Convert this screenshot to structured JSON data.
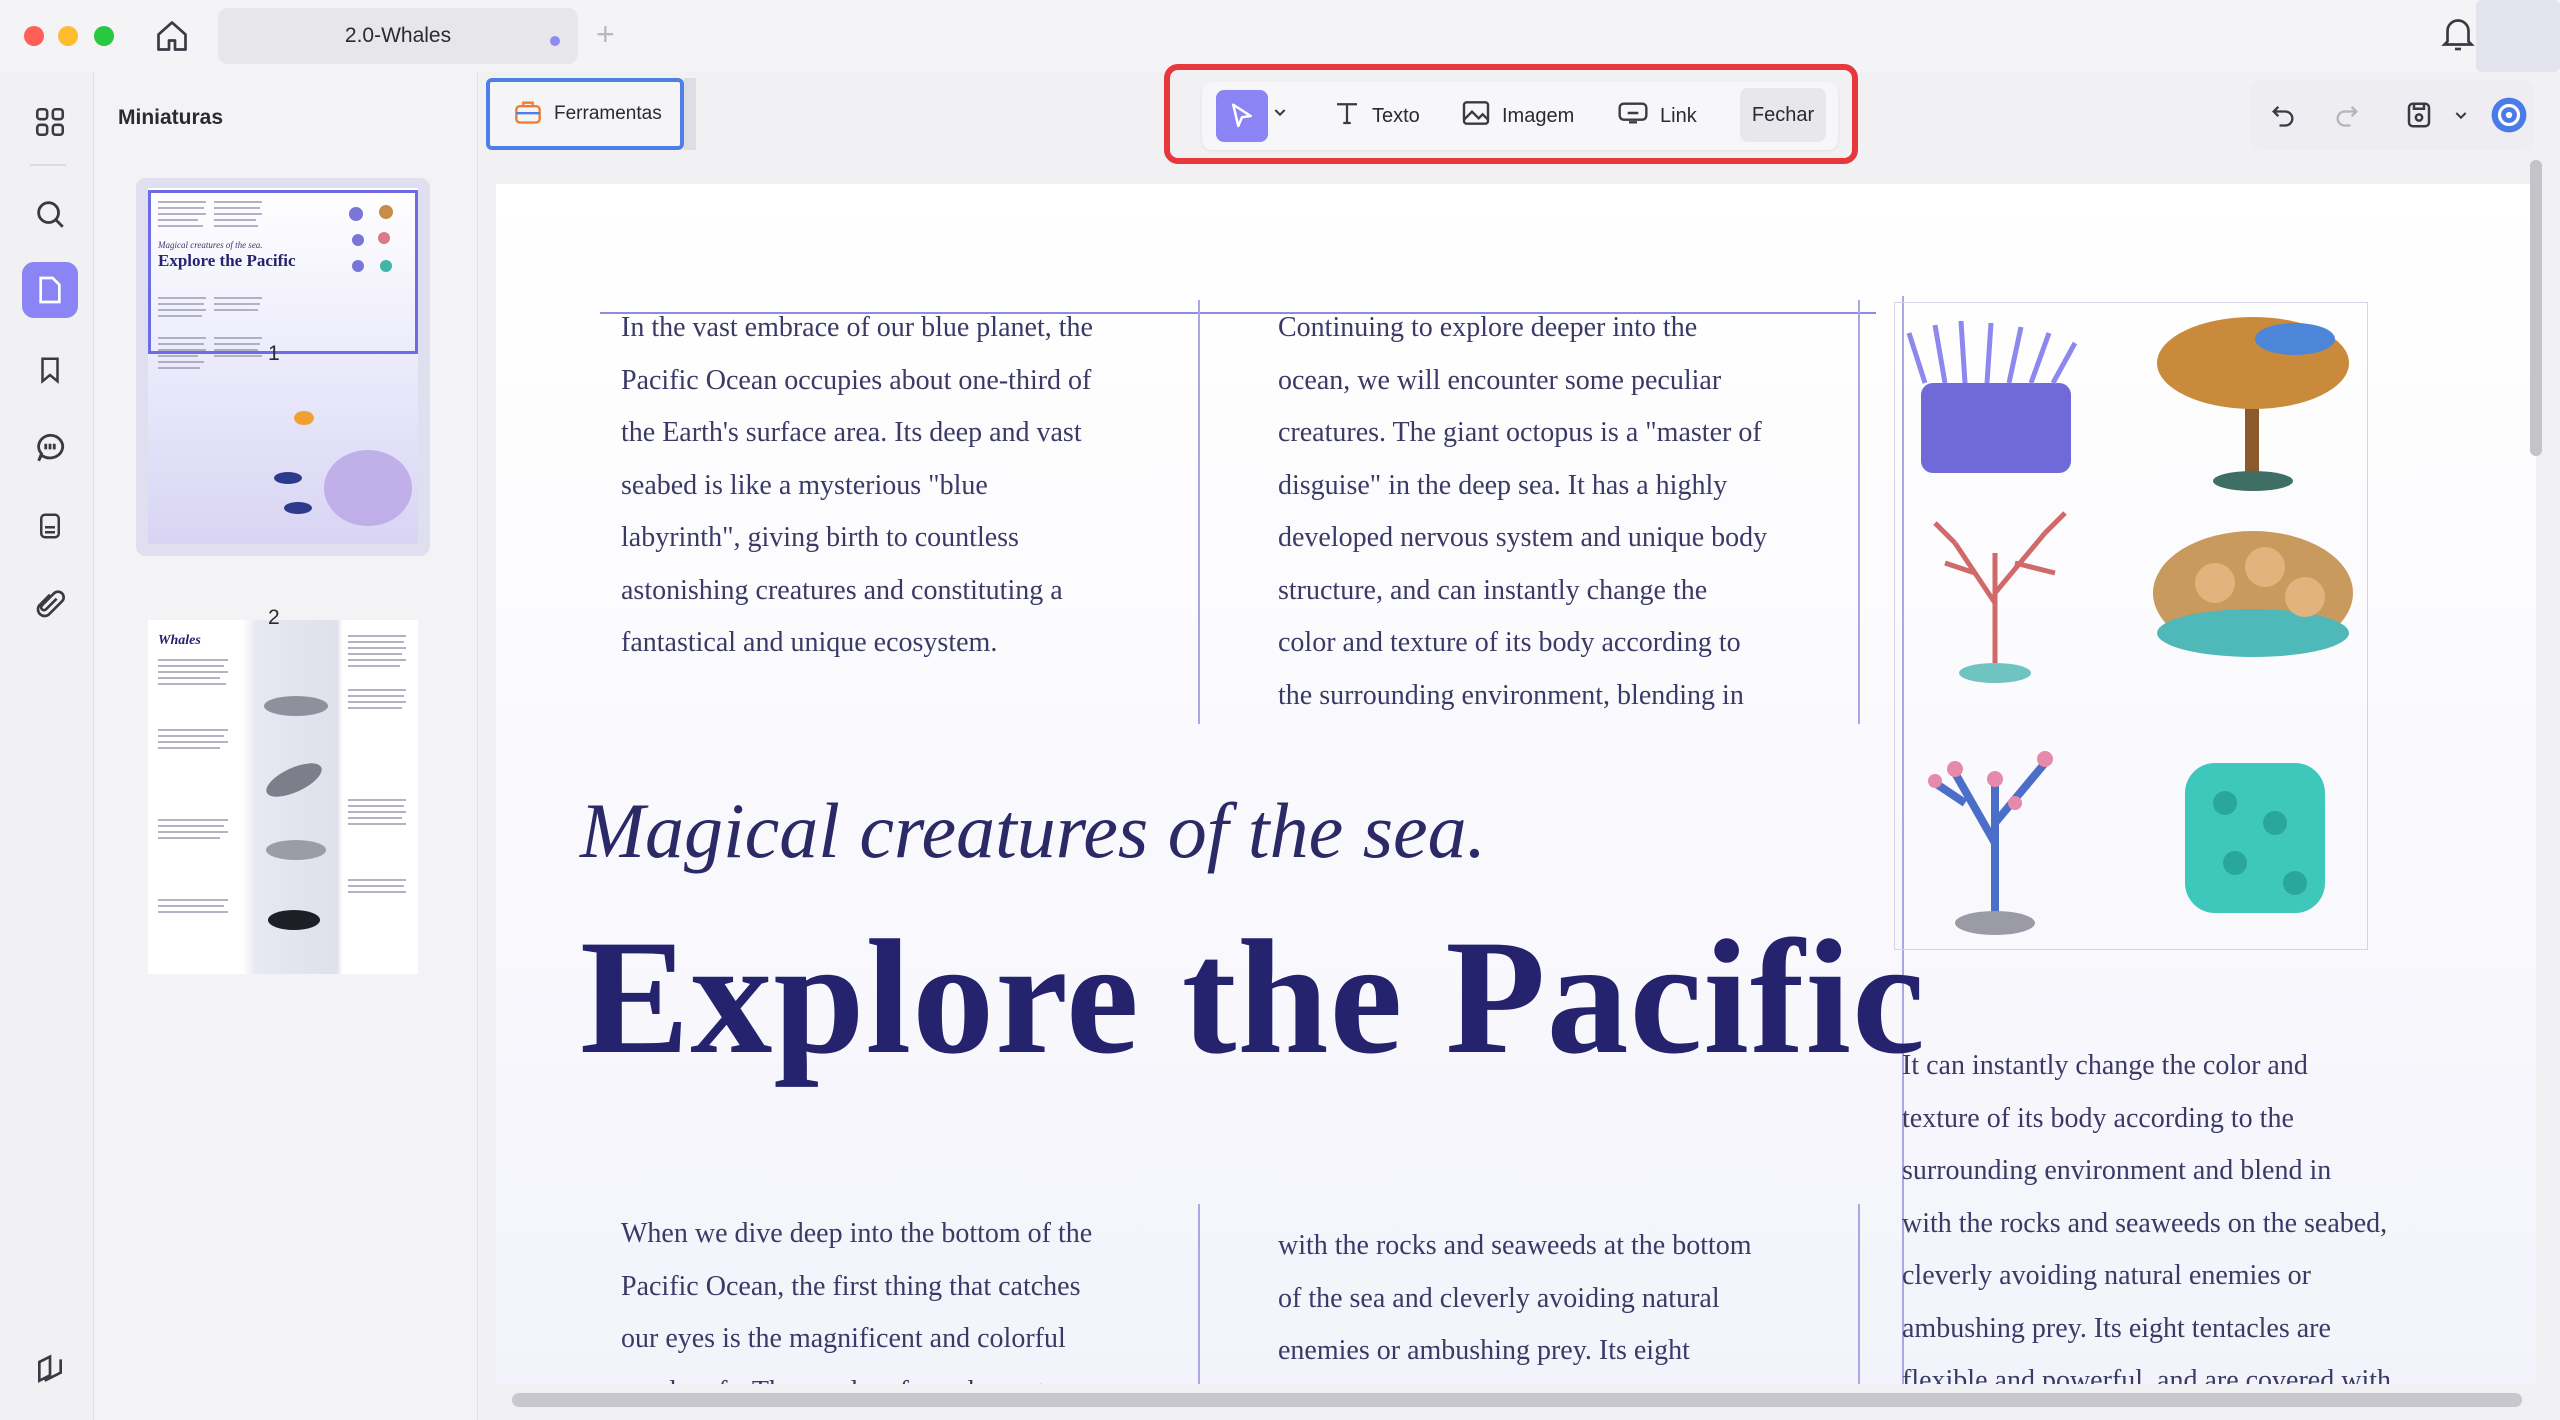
{
  "window": {
    "tab_title": "2.0-Whales",
    "new_tab_symbol": "+"
  },
  "sidebar": {
    "icons": [
      "grid-icon",
      "search-icon",
      "page-icon",
      "bookmark-icon",
      "comment-icon",
      "form-icon",
      "attachment-icon",
      "layers-icon"
    ],
    "active": "page-icon"
  },
  "thumbnails": {
    "title": "Miniaturas",
    "pages": [
      {
        "number": "1",
        "heading_script": "Magical creatures of the sea.",
        "heading": "Explore the Pacific"
      },
      {
        "number": "2",
        "heading": "Whales"
      }
    ]
  },
  "toolbar": {
    "tools_label": "Ferramentas",
    "edit_items": [
      {
        "label": "Texto",
        "icon": "text-icon"
      },
      {
        "label": "Imagem",
        "icon": "image-icon"
      },
      {
        "label": "Link",
        "icon": "link-icon"
      }
    ],
    "close_label": "Fechar",
    "highlight_color": "#e8383d",
    "accent_color": "#8b84f5"
  },
  "document": {
    "col1_top": [
      "In the vast embrace of our blue planet, the",
      "Pacific Ocean occupies about one-third of",
      "the Earth's surface area. Its deep and vast",
      "seabed is like a mysterious \"blue",
      "labyrinth\", giving birth to countless",
      "astonishing creatures and constituting a",
      "fantastical and unique ecosystem."
    ],
    "col2_top": [
      "Continuing to explore deeper into the",
      "ocean, we will encounter some peculiar",
      "creatures. The giant octopus is a \"master of",
      "disguise\" in the deep sea. It has a highly",
      "developed nervous system and unique body",
      "structure, and can instantly change the",
      "color and texture of its body according to",
      "the surrounding environment, blending in"
    ],
    "subtitle": "Magical creatures of the sea.",
    "title": "Explore the Pacific",
    "col1_bottom": [
      "When we dive deep into the bottom of the",
      "Pacific Ocean, the first thing that catches",
      "our eyes is the magnificent and colorful",
      "coral reefs. The coral reefs are home to"
    ],
    "col2_bottom": [
      "with the rocks and seaweeds at the bottom",
      "of the sea and cleverly avoiding natural",
      "enemies or ambushing prey. Its eight"
    ],
    "col3_bottom": [
      "It can instantly change the color and",
      "texture of its body according to the",
      "surrounding environment and blend in",
      "with the rocks and seaweeds on the seabed,",
      "cleverly avoiding natural enemies or",
      "ambushing prey. Its eight tentacles are",
      "flexible and powerful, and are covered with"
    ]
  }
}
